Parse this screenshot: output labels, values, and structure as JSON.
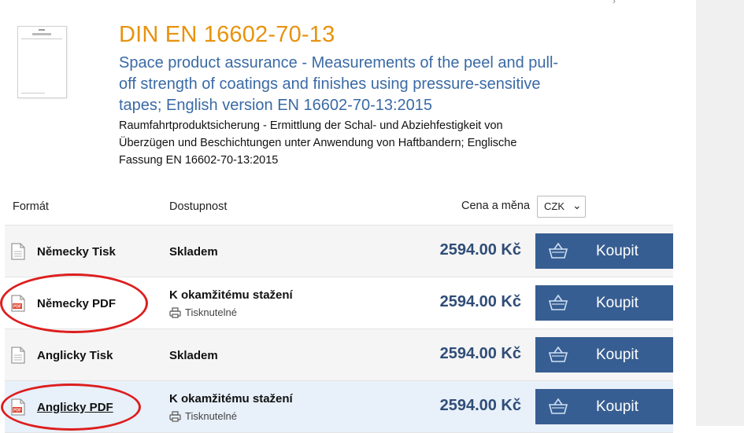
{
  "product": {
    "code": "DIN EN 16602-70-13",
    "title_en": "Space product assurance - Measurements of the peel and pull-off strength of coatings and finishes using pressure-sensitive tapes; English version EN 16602-70-13:2015",
    "title_de": "Raumfahrtproduktsicherung - Ermittlung der Schal- und Abziehfestigkeit von Überzügen und Beschichtungen unter Anwendung von Haftbandern; Englische Fassung EN 16602-70-13:2015"
  },
  "table": {
    "headers": {
      "format": "Formát",
      "availability": "Dostupnost",
      "price": "Cena a měna"
    },
    "currency": "CZK",
    "rows": [
      {
        "format": "Německy Tisk",
        "icon": "document-icon",
        "availability": "Skladem",
        "printable": "",
        "price": "2594.00 Kč",
        "buy_label": "Koupit"
      },
      {
        "format": "Německy PDF",
        "icon": "pdf-icon",
        "availability": "K okamžitému stažení",
        "printable": "Tisknutelné",
        "price": "2594.00 Kč",
        "buy_label": "Koupit"
      },
      {
        "format": "Anglicky Tisk",
        "icon": "document-icon",
        "availability": "Skladem",
        "printable": "",
        "price": "2594.00 Kč",
        "buy_label": "Koupit"
      },
      {
        "format": "Anglicky PDF",
        "icon": "pdf-icon",
        "availability": "K okamžitému stažení",
        "printable": "Tisknutelné",
        "price": "2594.00 Kč",
        "buy_label": "Koupit"
      }
    ]
  },
  "colors": {
    "title": "#e8920e",
    "subtitle": "#3a6aa5",
    "price": "#2f4d77",
    "buy_button": "#375e92",
    "annotation": "#dd1e1e"
  }
}
